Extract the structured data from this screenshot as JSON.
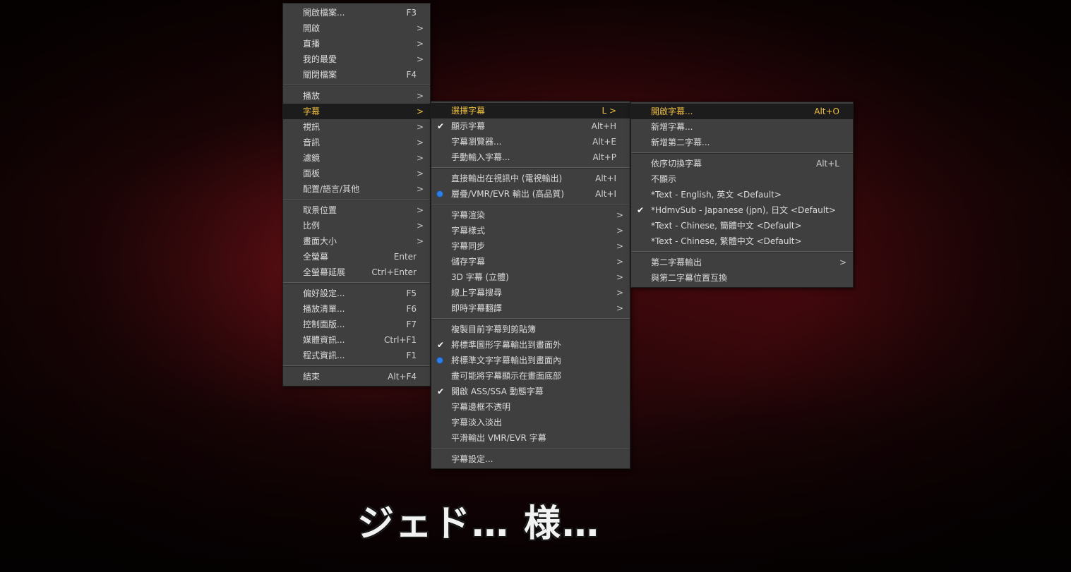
{
  "main_menu": {
    "groups": [
      [
        {
          "label": "開啟檔案...",
          "shortcut": "F3"
        },
        {
          "label": "開啟",
          "submenu": true
        },
        {
          "label": "直播",
          "submenu": true
        },
        {
          "label": "我的最愛",
          "submenu": true
        },
        {
          "label": "關閉檔案",
          "shortcut": "F4"
        }
      ],
      [
        {
          "label": "播放",
          "submenu": true
        },
        {
          "label": "字幕",
          "submenu": true,
          "active": true
        },
        {
          "label": "視訊",
          "submenu": true
        },
        {
          "label": "音訊",
          "submenu": true
        },
        {
          "label": "濾鏡",
          "submenu": true
        },
        {
          "label": "面板",
          "submenu": true
        },
        {
          "label": "配置/語言/其他",
          "submenu": true
        }
      ],
      [
        {
          "label": "取景位置",
          "submenu": true
        },
        {
          "label": "比例",
          "submenu": true
        },
        {
          "label": "畫面大小",
          "submenu": true
        },
        {
          "label": "全螢幕",
          "shortcut": "Enter"
        },
        {
          "label": "全螢幕延展",
          "shortcut": "Ctrl+Enter"
        }
      ],
      [
        {
          "label": "偏好設定...",
          "shortcut": "F5"
        },
        {
          "label": "播放清單...",
          "shortcut": "F6"
        },
        {
          "label": "控制面版...",
          "shortcut": "F7"
        },
        {
          "label": "媒體資訊...",
          "shortcut": "Ctrl+F1"
        },
        {
          "label": "程式資訊...",
          "shortcut": "F1"
        }
      ],
      [
        {
          "label": "結束",
          "shortcut": "Alt+F4"
        }
      ]
    ]
  },
  "subtitle_menu": {
    "groups": [
      [
        {
          "label": "選擇字幕",
          "shortcut": "L >",
          "active": true
        },
        {
          "label": "顯示字幕",
          "shortcut": "Alt+H",
          "mark": "check"
        },
        {
          "label": "字幕瀏覽器...",
          "shortcut": "Alt+E"
        },
        {
          "label": "手動輸入字幕...",
          "shortcut": "Alt+P"
        }
      ],
      [
        {
          "label": "直接輸出在視訊中 (電視輸出)",
          "shortcut": "Alt+I"
        },
        {
          "label": "層疊/VMR/EVR 輸出 (高品質)",
          "shortcut": "Alt+I",
          "mark": "radio"
        }
      ],
      [
        {
          "label": "字幕渲染",
          "submenu": true
        },
        {
          "label": "字幕樣式",
          "submenu": true
        },
        {
          "label": "字幕同步",
          "submenu": true
        },
        {
          "label": "儲存字幕",
          "submenu": true
        },
        {
          "label": "3D 字幕 (立體)",
          "submenu": true
        },
        {
          "label": "線上字幕搜尋",
          "submenu": true
        },
        {
          "label": "即時字幕翻譯",
          "submenu": true
        }
      ],
      [
        {
          "label": "複製目前字幕到剪貼簿"
        },
        {
          "label": "將標準圖形字幕輸出到畫面外",
          "mark": "check"
        },
        {
          "label": "將標準文字字幕輸出到畫面內",
          "mark": "radio"
        },
        {
          "label": "盡可能將字幕顯示在畫面底部"
        },
        {
          "label": "開啟 ASS/SSA 動態字幕",
          "mark": "check"
        },
        {
          "label": "字幕邊框不透明"
        },
        {
          "label": "字幕淡入淡出"
        },
        {
          "label": "平滑輸出 VMR/EVR 字幕"
        }
      ],
      [
        {
          "label": "字幕設定..."
        }
      ]
    ]
  },
  "select_subtitle_menu": {
    "groups": [
      [
        {
          "label": "開啟字幕...",
          "shortcut": "Alt+O",
          "active": true
        },
        {
          "label": "新增字幕..."
        },
        {
          "label": "新增第二字幕..."
        }
      ],
      [
        {
          "label": "依序切換字幕",
          "shortcut": "Alt+L"
        },
        {
          "label": "不顯示"
        },
        {
          "label": "*Text - English, 英文 <Default>"
        },
        {
          "label": "*HdmvSub - Japanese (jpn), 日文 <Default>",
          "mark": "check"
        },
        {
          "label": "*Text - Chinese, 簡體中文 <Default>"
        },
        {
          "label": "*Text - Chinese, 繁體中文 <Default>"
        }
      ],
      [
        {
          "label": "第二字幕輸出",
          "submenu": true
        },
        {
          "label": "與第二字幕位置互換"
        }
      ]
    ]
  },
  "video": {
    "subtitle_text": "ジェド… 様…"
  },
  "colors": {
    "menu_bg": "#3f3f3f",
    "highlight_bg": "#1c1c1c",
    "highlight_text": "#f0c040",
    "radio_dot": "#2d7fe6"
  },
  "icons": {
    "check": "check-icon",
    "radio": "radio-dot-icon",
    "submenu": "chevron-right-icon"
  }
}
